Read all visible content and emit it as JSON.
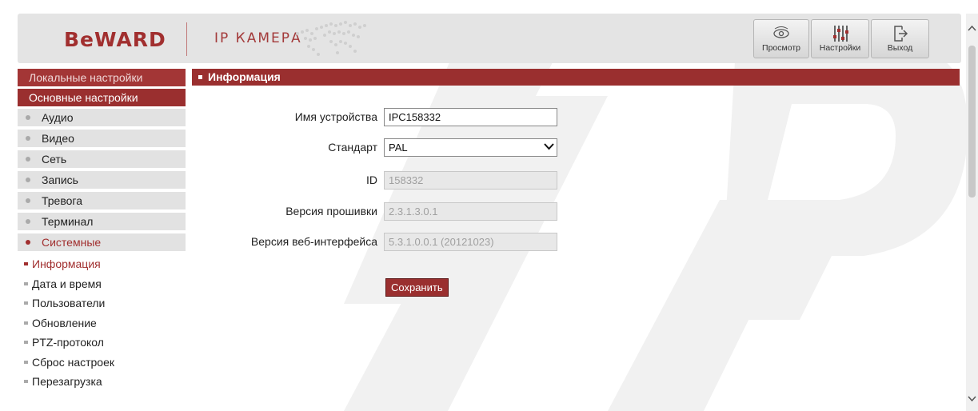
{
  "header": {
    "logo": "BeWARD",
    "product": "IP КАМЕРА",
    "buttons": [
      {
        "label": "Просмотр",
        "icon": "eye-icon"
      },
      {
        "label": "Настройки",
        "icon": "sliders-icon"
      },
      {
        "label": "Выход",
        "icon": "logout-icon"
      }
    ]
  },
  "sidebar": {
    "local_settings": "Локальные настройки",
    "main_settings": "Основные настройки",
    "items": [
      {
        "label": "Аудио"
      },
      {
        "label": "Видео"
      },
      {
        "label": "Сеть"
      },
      {
        "label": "Запись"
      },
      {
        "label": "Тревога"
      },
      {
        "label": "Терминал"
      },
      {
        "label": "Системные",
        "active": true
      }
    ],
    "subitems": [
      {
        "label": "Информация",
        "active": true
      },
      {
        "label": "Дата и время"
      },
      {
        "label": "Пользователи"
      },
      {
        "label": "Обновление"
      },
      {
        "label": "PTZ-протокол"
      },
      {
        "label": "Сброс настроек"
      },
      {
        "label": "Перезагрузка"
      }
    ]
  },
  "main": {
    "section_title": "Информация",
    "fields": {
      "device_name": {
        "label": "Имя устройства",
        "value": "IPC158332"
      },
      "standard": {
        "label": "Стандарт",
        "value": "PAL"
      },
      "id": {
        "label": "ID",
        "value": "158332"
      },
      "firmware": {
        "label": "Версия прошивки",
        "value": "2.3.1.3.0.1"
      },
      "web_version": {
        "label": "Версия веб-интерфейса",
        "value": "5.3.1.0.0.1 (20121023)"
      }
    },
    "save_label": "Сохранить"
  },
  "colors": {
    "accent": "#9a2f2f",
    "header_bg": "#e4e4e4",
    "sidebar_item_bg": "#e2e2e2",
    "disabled_field_bg": "#e8e8e8"
  }
}
